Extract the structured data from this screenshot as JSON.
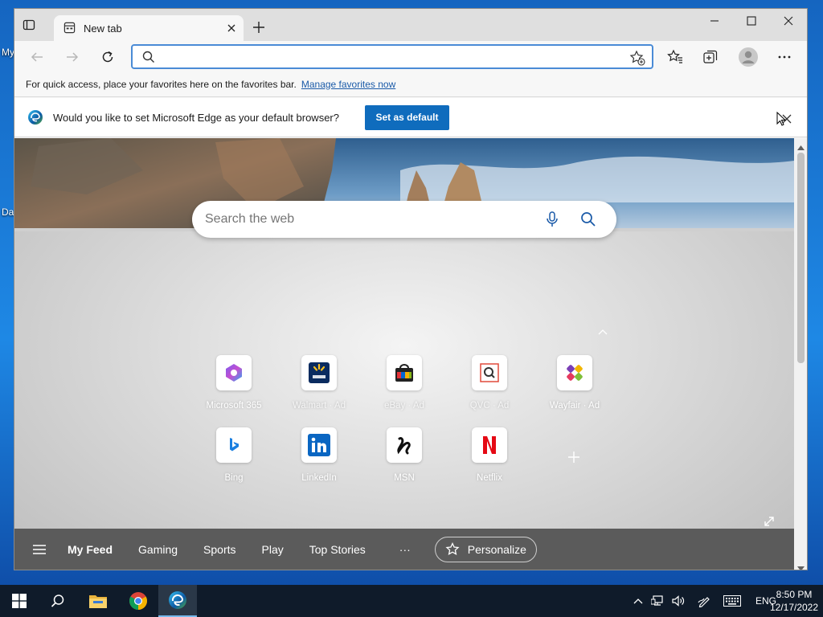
{
  "desktop": {
    "icon_label_1": "My",
    "icon_label_2": "Da"
  },
  "browser": {
    "tab": {
      "title": "New tab"
    },
    "address_bar": {
      "value": "",
      "placeholder": ""
    },
    "favorites_bar": {
      "message": "For quick access, place your favorites here on the favorites bar.",
      "link": "Manage favorites now"
    },
    "infobar": {
      "message": "Would you like to set Microsoft Edge as your default browser?",
      "button": "Set as default"
    }
  },
  "newtab": {
    "search_placeholder": "Search the web",
    "tiles": [
      {
        "label": "Microsoft 365",
        "icon": "microsoft-365-icon"
      },
      {
        "label": "Walmart · Ad",
        "icon": "walmart-icon"
      },
      {
        "label": "eBay · Ad",
        "icon": "ebay-icon"
      },
      {
        "label": "QVC · Ad",
        "icon": "qvc-icon"
      },
      {
        "label": "Wayfair · Ad",
        "icon": "wayfair-icon"
      },
      {
        "label": "Bing",
        "icon": "bing-icon"
      },
      {
        "label": "LinkedIn",
        "icon": "linkedin-icon"
      },
      {
        "label": "MSN",
        "icon": "msn-icon"
      },
      {
        "label": "Netflix",
        "icon": "netflix-icon"
      }
    ],
    "feed_nav": {
      "items": [
        "My Feed",
        "Gaming",
        "Sports",
        "Play",
        "Top Stories"
      ],
      "more": "···",
      "personalize": "Personalize"
    }
  },
  "taskbar": {
    "language": "ENG",
    "time": "8:50 PM",
    "date": "12/17/2022"
  },
  "colors": {
    "accent": "#0f6cbd",
    "link": "#1a5aa8",
    "feedbar": "#5b5b5b",
    "taskbar": "#0f1b2a"
  }
}
